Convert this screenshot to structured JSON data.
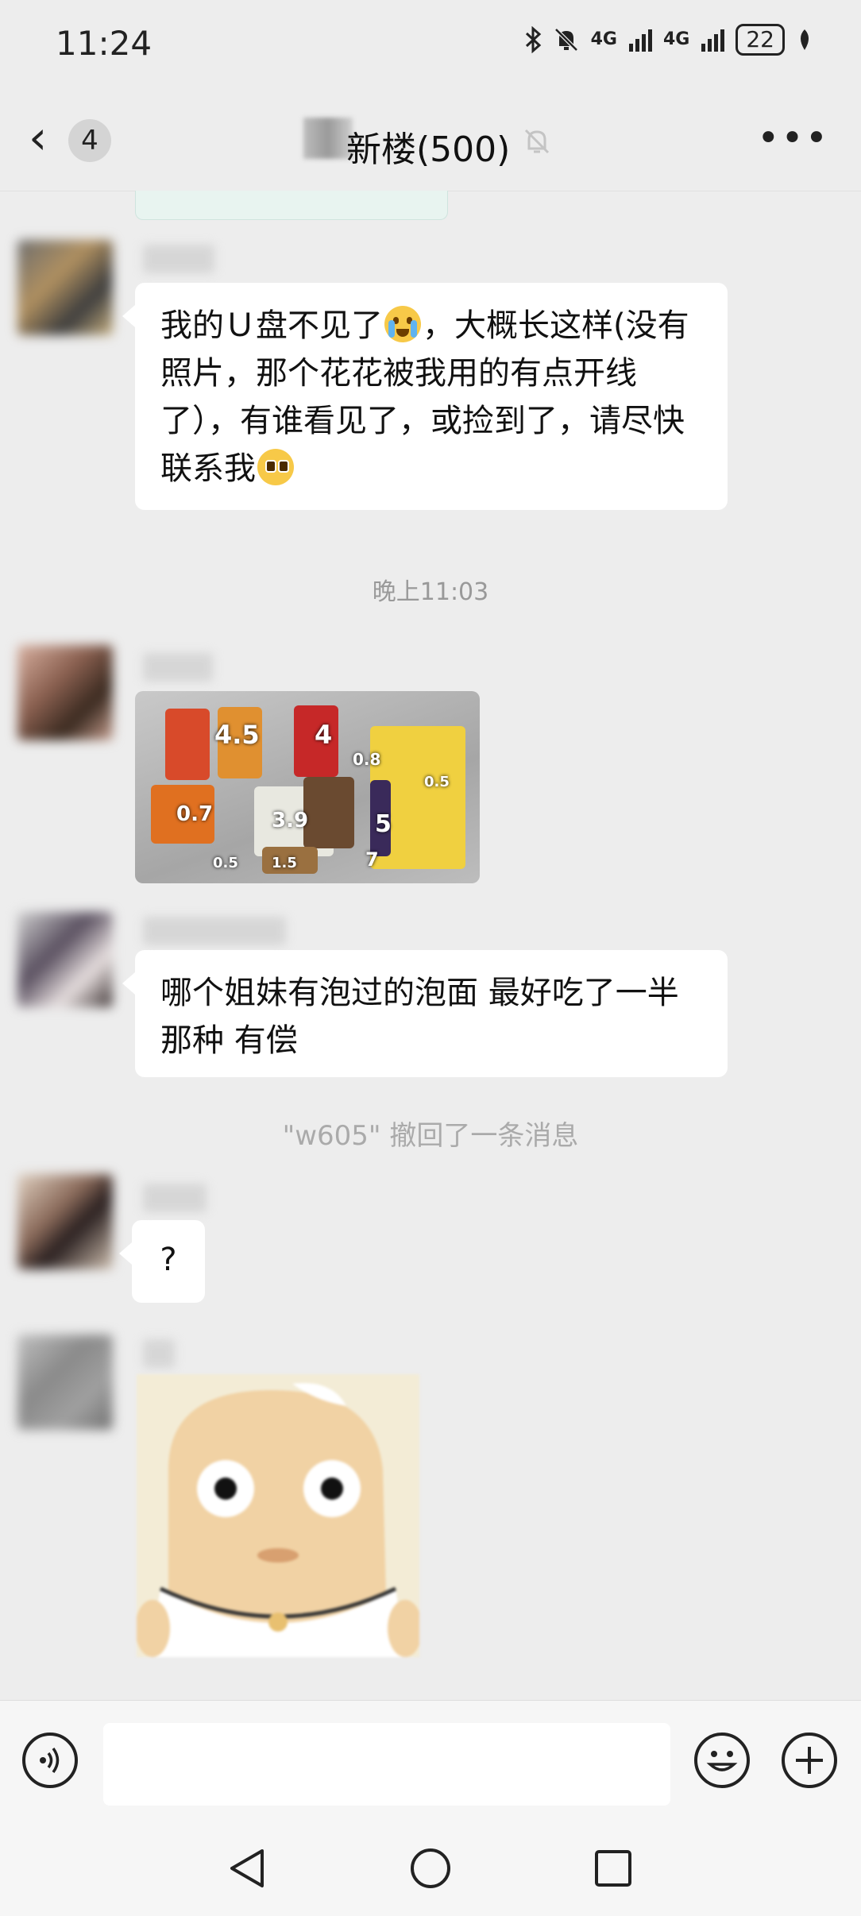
{
  "status_bar": {
    "time": "11:24",
    "network_1": "4G",
    "network_2": "4G",
    "battery": "22"
  },
  "header": {
    "unread_count": "4",
    "title": "新楼(500)"
  },
  "messages": [
    {
      "type": "text",
      "text_parts": [
        "我的Ｕ盘不见了",
        "，大概长这样(没有照片，那个花花被我用的有点开线了），有谁看见了，或捡到了，请尽快联系我"
      ],
      "emoji": [
        "loudly-crying-face",
        "pleading-face"
      ]
    },
    {
      "type": "timestamp",
      "text": "晚上11:03"
    },
    {
      "type": "image",
      "labels": [
        "4.5",
        "4",
        "0.8",
        "0.5",
        "0.7",
        "3.9",
        "5",
        "0.5",
        "1.5",
        "7"
      ]
    },
    {
      "type": "text",
      "text": "哪个姐妹有泡过的泡面 最好吃了一半那种 有偿"
    },
    {
      "type": "system",
      "text": "\"w605\" 撤回了一条消息"
    },
    {
      "type": "text",
      "text": "?"
    },
    {
      "type": "sticker"
    }
  ],
  "input": {
    "value": ""
  },
  "colors": {
    "background": "#ededed",
    "bubble": "#ffffff",
    "bar": "#f6f6f6"
  }
}
